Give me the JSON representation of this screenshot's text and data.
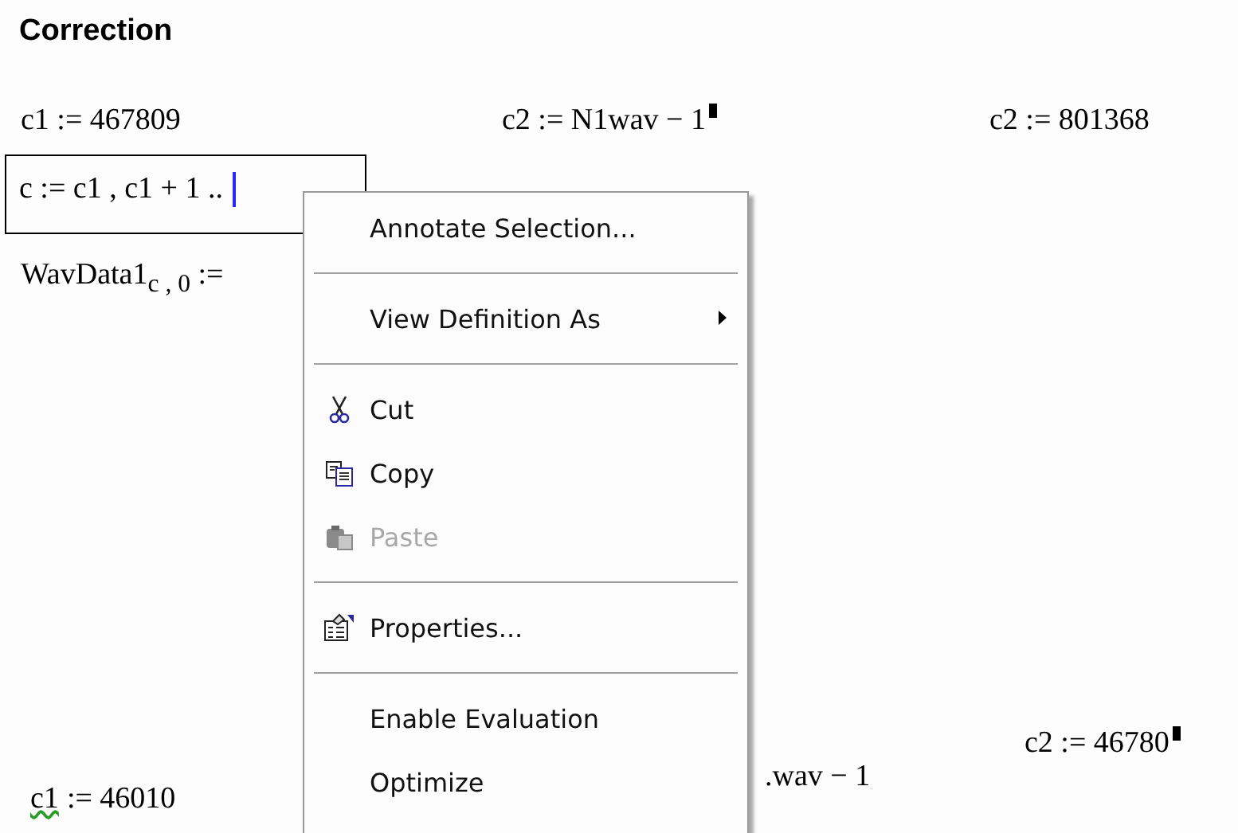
{
  "heading": "Correction",
  "regions": [
    {
      "text": "c1 := 467809",
      "selected": false
    },
    {
      "text": "c2 := N1wav − 1",
      "selected": false,
      "marker": true
    },
    {
      "text": "c2 := 801368",
      "selected": false
    },
    {
      "text": "c := c1 , c1 + 1 ..",
      "selected": true,
      "cursor": true
    },
    {
      "text": "WavData1$_{c , 0}$ :=",
      "selected": false
    },
    {
      "text": "c2 := 46780",
      "selected": false,
      "marker": true
    },
    {
      "text": ":= 46010",
      "flag_text": "c1",
      "selected": false,
      "flagged": true
    },
    {
      "text": ".wav − 1",
      "selected": false
    }
  ],
  "context_menu": {
    "items": [
      {
        "kind": "item",
        "label": "Annotate Selection...",
        "disabled": false,
        "submenu": false
      },
      {
        "kind": "separator"
      },
      {
        "kind": "item",
        "label": "View Definition As",
        "disabled": false,
        "submenu": true
      },
      {
        "kind": "separator"
      },
      {
        "kind": "item",
        "label": "Cut",
        "disabled": false,
        "submenu": false
      },
      {
        "kind": "item",
        "label": "Copy",
        "disabled": false,
        "submenu": false
      },
      {
        "kind": "item",
        "label": "Paste",
        "disabled": true,
        "submenu": false
      },
      {
        "kind": "separator"
      },
      {
        "kind": "item",
        "label": "Properties...",
        "disabled": false,
        "submenu": false
      },
      {
        "kind": "separator"
      },
      {
        "kind": "item",
        "label": "Enable Evaluation",
        "disabled": false,
        "submenu": false
      },
      {
        "kind": "item",
        "label": "Optimize",
        "disabled": false,
        "submenu": false
      }
    ]
  }
}
